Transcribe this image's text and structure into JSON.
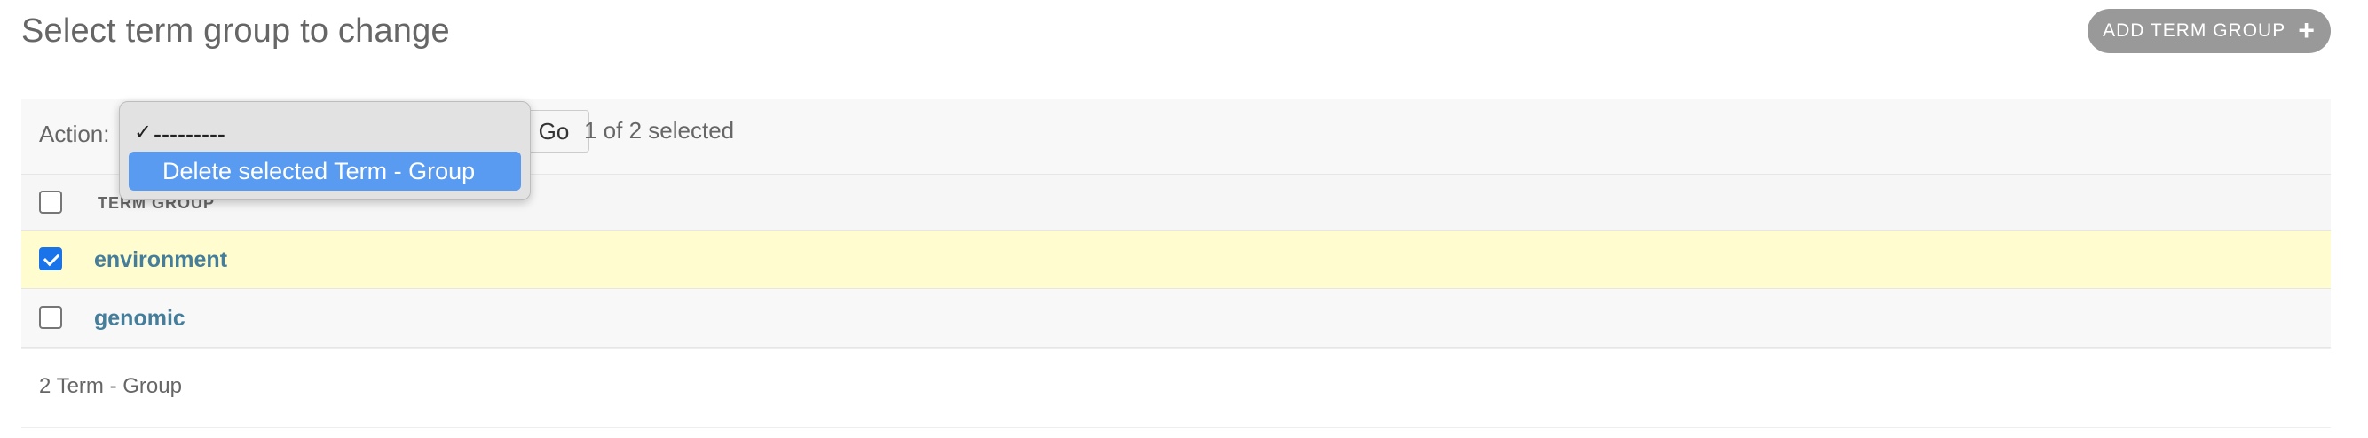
{
  "header": {
    "title": "Select term group to change",
    "add_button_label": "ADD TERM GROUP",
    "add_icon": "plus-icon"
  },
  "actions": {
    "label": "Action:",
    "options": [
      "---------",
      "Delete selected Term - Group"
    ],
    "selected_option": "---------",
    "highlighted_option": "Delete selected Term - Group",
    "go_label": "Go",
    "selection_count": "1 of 2 selected"
  },
  "table": {
    "column_header": "TERM GROUP",
    "rows": [
      {
        "label": "environment",
        "checked": true
      },
      {
        "label": "genomic",
        "checked": false
      }
    ]
  },
  "footer": {
    "count": "2 Term - Group"
  },
  "colors": {
    "link": "#447e9b",
    "selected_row": "#fffccf",
    "add_button": "#999999",
    "dropdown_highlight": "#5a9bf2",
    "checkbox_checked": "#1a73e8"
  }
}
